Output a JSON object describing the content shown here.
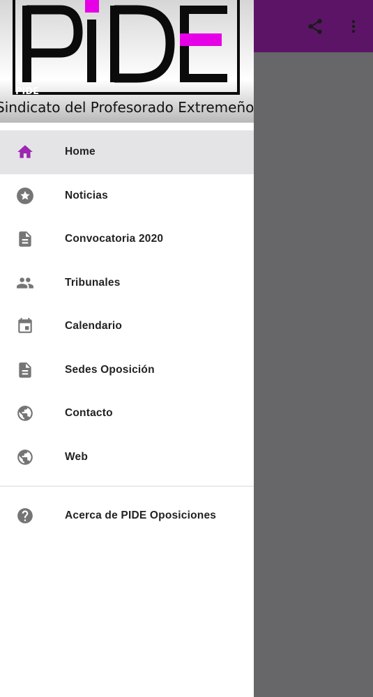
{
  "drawer": {
    "logo_text": "PIDE",
    "logo_caption": "PIDE",
    "subtitle": "Sindicato del Profesorado Extremeño"
  },
  "menu": {
    "items": [
      {
        "label": "Home",
        "icon": "home-icon"
      },
      {
        "label": "Noticias",
        "icon": "star-icon"
      },
      {
        "label": "Convocatoria 2020",
        "icon": "document-icon"
      },
      {
        "label": "Tribunales",
        "icon": "people-icon"
      },
      {
        "label": "Calendario",
        "icon": "calendar-icon"
      },
      {
        "label": "Sedes Oposición",
        "icon": "document-icon"
      },
      {
        "label": "Contacto",
        "icon": "globe-icon"
      },
      {
        "label": "Web",
        "icon": "globe-icon"
      }
    ],
    "about_label": "Acerca de PIDE Oposiciones",
    "about_icon": "help-icon"
  },
  "appbar": {
    "actions": [
      "share-icon",
      "more-vert-icon"
    ]
  },
  "colors": {
    "accent": "#9c27b0",
    "appbar": "#5c1566",
    "logo_magenta": "#e600e6",
    "icon_gray": "#757575",
    "scrim": "#676669",
    "active_bg": "#e4e4e6"
  }
}
